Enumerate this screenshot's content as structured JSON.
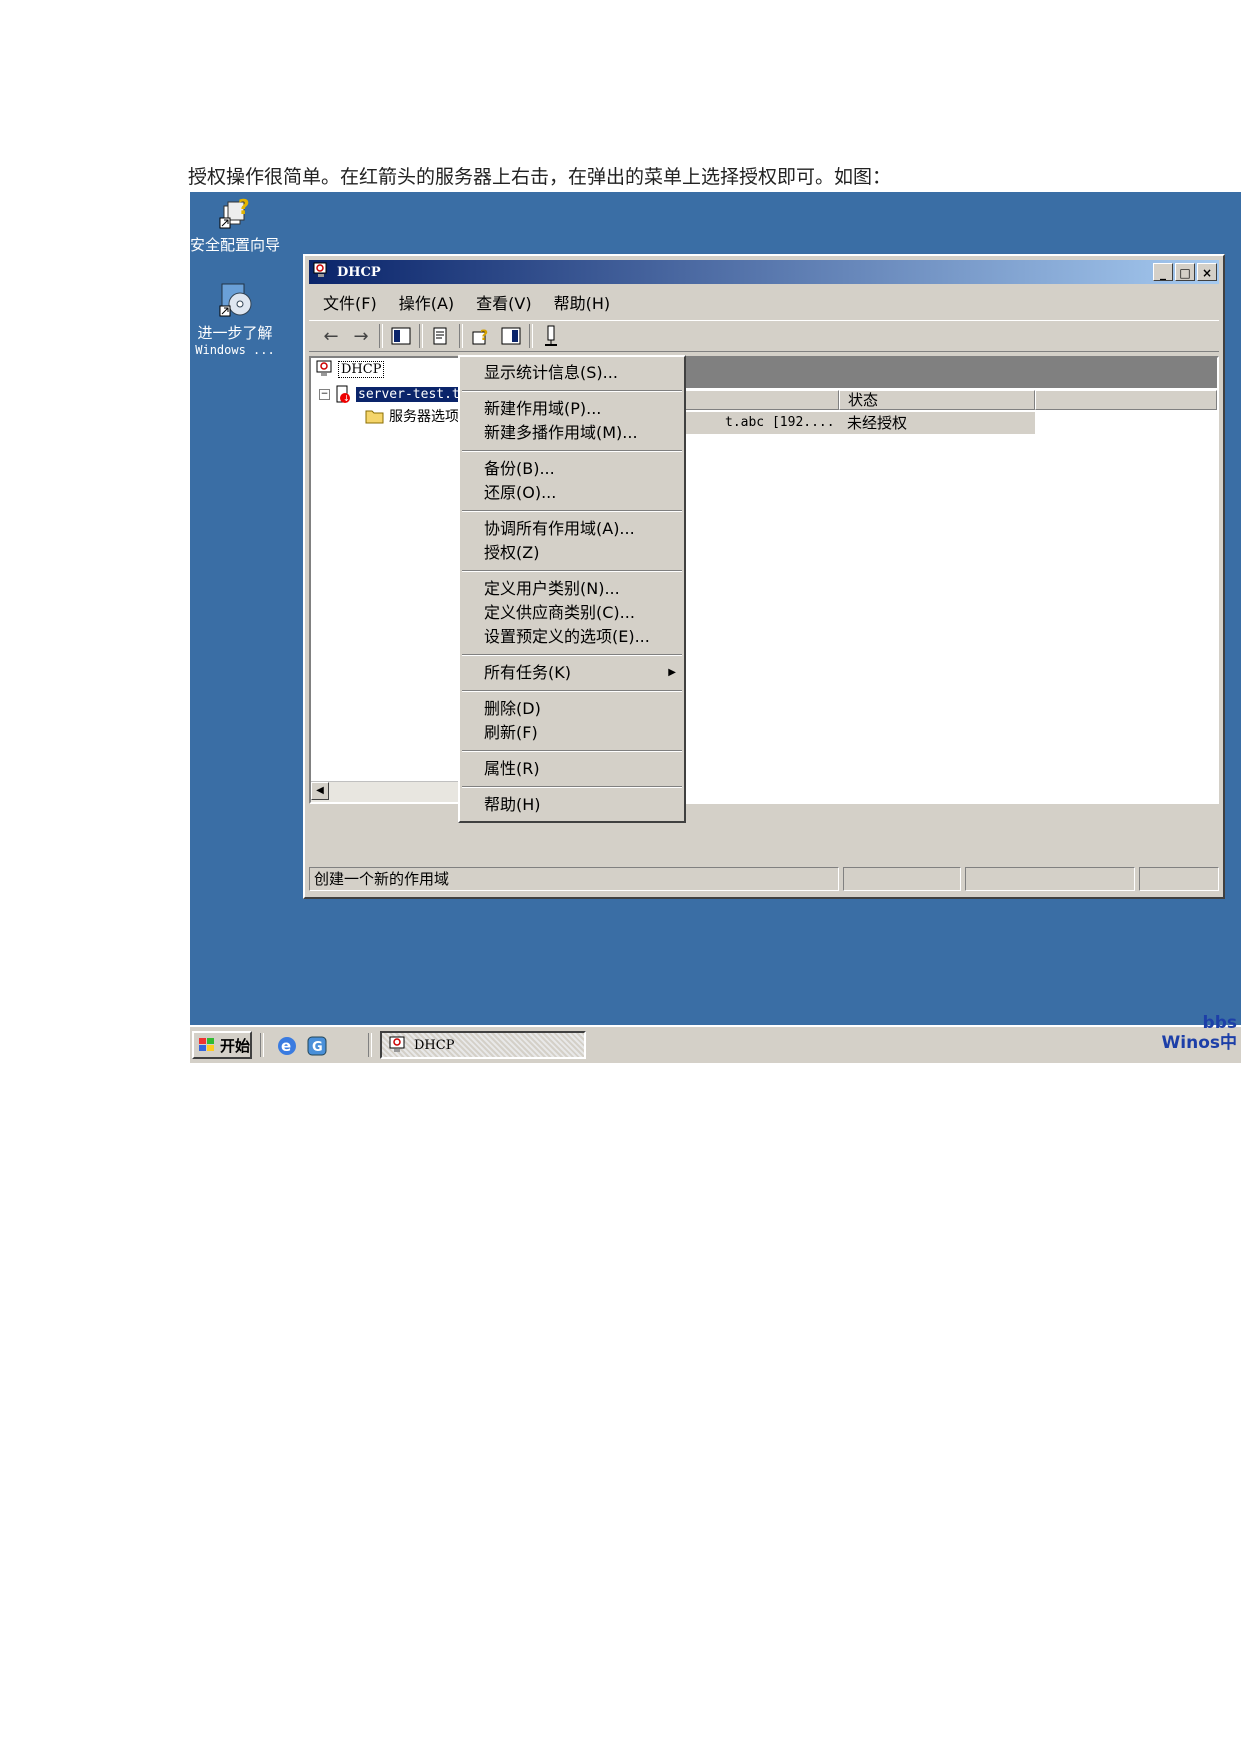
{
  "caption": "授权操作很简单。在红箭头的服务器上右击，在弹出的菜单上选择授权即可。如图：",
  "desktop": {
    "icons": [
      {
        "label": "安全配置向导",
        "sub": ""
      },
      {
        "label": "进一步了解",
        "sub": "Windows ..."
      }
    ]
  },
  "window": {
    "title": "DHCP",
    "menus": [
      "文件(F)",
      "操作(A)",
      "查看(V)",
      "帮助(H)"
    ],
    "tree": {
      "root": "DHCP",
      "server": "server-test.test... [192",
      "child": "服务器选项"
    },
    "right_pane": {
      "header": "DHCP",
      "columns": [
        "",
        "状态"
      ],
      "row": {
        "name": "t.abc [192....",
        "status": "未经授权"
      }
    },
    "statusbar": "创建一个新的作用域"
  },
  "context_menu": {
    "groups": [
      [
        "显示统计信息(S)..."
      ],
      [
        "新建作用域(P)...",
        "新建多播作用域(M)..."
      ],
      [
        "备份(B)...",
        "还原(O)..."
      ],
      [
        "协调所有作用域(A)...",
        "授权(Z)"
      ],
      [
        "定义用户类别(N)...",
        "定义供应商类别(C)...",
        "设置预定义的选项(E)..."
      ],
      [
        "所有任务(K)"
      ],
      [
        "删除(D)",
        "刷新(F)"
      ],
      [
        "属性(R)"
      ],
      [
        "帮助(H)"
      ]
    ]
  },
  "taskbar": {
    "start": "开始",
    "task": "DHCP",
    "watermark_top": "bbs",
    "watermark_bottom": "Winos中"
  },
  "colors": {
    "desktop": "#3a6ea5",
    "titlebar": "#0a246a",
    "chrome": "#d4d0c8",
    "selection": "#0a246a"
  }
}
